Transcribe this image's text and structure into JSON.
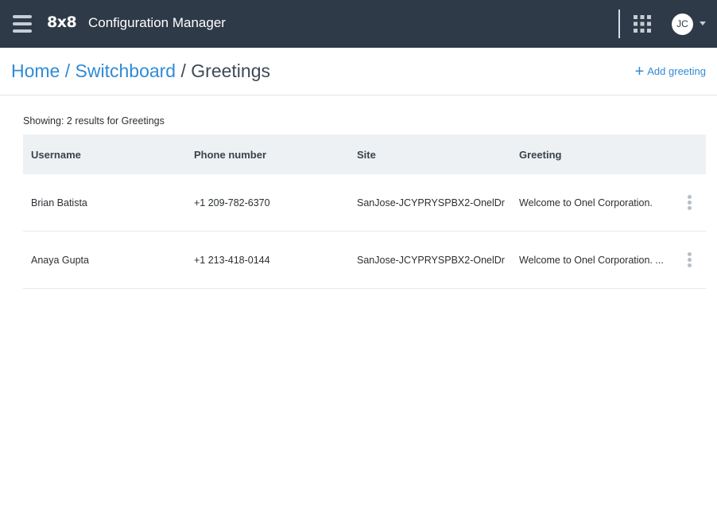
{
  "topbar": {
    "logo": "8x8",
    "app_title": "Configuration Manager",
    "avatar_initials": "JC",
    "menu_icon": "hamburger-menu-icon",
    "apps_icon": "apps-grid-icon",
    "dropdown_icon": "caret-down-icon",
    "background": "#2e3a47"
  },
  "breadcrumb": {
    "items": [
      "Home",
      "Switchboard",
      "Greetings"
    ],
    "separator": "/"
  },
  "actions": {
    "add_label": "Add greeting",
    "add_icon": "plus-icon"
  },
  "results": {
    "text": "Showing: 2 results for Greetings"
  },
  "table": {
    "columns": [
      "Username",
      "Phone number",
      "Site",
      "Greeting"
    ],
    "rows": [
      {
        "username": "Brian Batista",
        "phone": "+1 209-782-6370",
        "site": "SanJose-JCYPRYSPBX2-OnelDr",
        "greeting": "Welcome to Onel Corporation."
      },
      {
        "username": "Anaya Gupta",
        "phone": "+1 213-418-0144",
        "site": "SanJose-JCYPRYSPBX2-OnelDr",
        "greeting": "Welcome to Onel Corporation. ..."
      }
    ],
    "row_menu_icon": "kebab-menu-icon"
  },
  "colors": {
    "link": "#2f8bd6",
    "header_bg": "#eef1f4"
  }
}
